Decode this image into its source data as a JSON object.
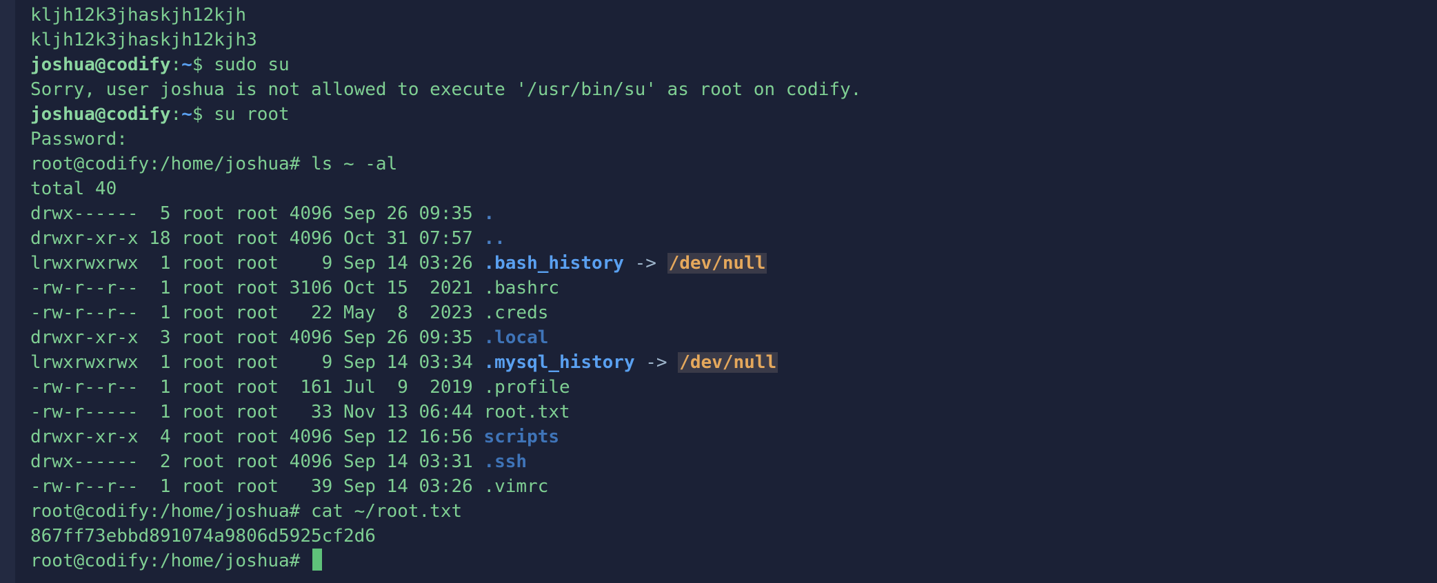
{
  "terminal": {
    "prompt_user": "joshua@codify",
    "prompt_path": "~",
    "prompt_sign": "$ ",
    "root_prompt": "root@codify:/home/joshua# "
  },
  "lines": {
    "l1": "kljh12k3jhaskjh12kjh",
    "l2": "kljh12k3jhaskjh12kjh3",
    "cmd_sudo": "sudo su",
    "sorry": "Sorry, user joshua is not allowed to execute '/usr/bin/su' as root on codify.",
    "cmd_su": "su root",
    "password": "Password:",
    "cmd_ls": "ls ~ -al",
    "total": "total 40",
    "cmd_cat": "cat ~/root.txt",
    "hash": "867ff73ebbd891074a9806d5925cf2d6"
  },
  "listing": [
    {
      "meta": "drwx------  5 root root 4096 Sep 26 09:35 ",
      "name": ".",
      "kind": "dir"
    },
    {
      "meta": "drwxr-xr-x 18 root root 4096 Oct 31 07:57 ",
      "name": "..",
      "kind": "dir"
    },
    {
      "meta": "lrwxrwxrwx  1 root root    9 Sep 14 03:26 ",
      "name": ".bash_history",
      "kind": "link",
      "arrow": " -> ",
      "target": "/dev/null"
    },
    {
      "meta": "-rw-r--r--  1 root root 3106 Oct 15  2021 ",
      "name": ".bashrc",
      "kind": "file"
    },
    {
      "meta": "-rw-r--r--  1 root root   22 May  8  2023 ",
      "name": ".creds",
      "kind": "file"
    },
    {
      "meta": "drwxr-xr-x  3 root root 4096 Sep 26 09:35 ",
      "name": ".local",
      "kind": "dir"
    },
    {
      "meta": "lrwxrwxrwx  1 root root    9 Sep 14 03:34 ",
      "name": ".mysql_history",
      "kind": "link",
      "arrow": " -> ",
      "target": "/dev/null"
    },
    {
      "meta": "-rw-r--r--  1 root root  161 Jul  9  2019 ",
      "name": ".profile",
      "kind": "file"
    },
    {
      "meta": "-rw-r-----  1 root root   33 Nov 13 06:44 ",
      "name": "root.txt",
      "kind": "file"
    },
    {
      "meta": "drwxr-xr-x  4 root root 4096 Sep 12 16:56 ",
      "name": "scripts",
      "kind": "dir"
    },
    {
      "meta": "drwx------  2 root root 4096 Sep 14 03:31 ",
      "name": ".ssh",
      "kind": "dir"
    },
    {
      "meta": "-rw-r--r--  1 root root   39 Sep 14 03:26 ",
      "name": ".vimrc",
      "kind": "file"
    }
  ]
}
